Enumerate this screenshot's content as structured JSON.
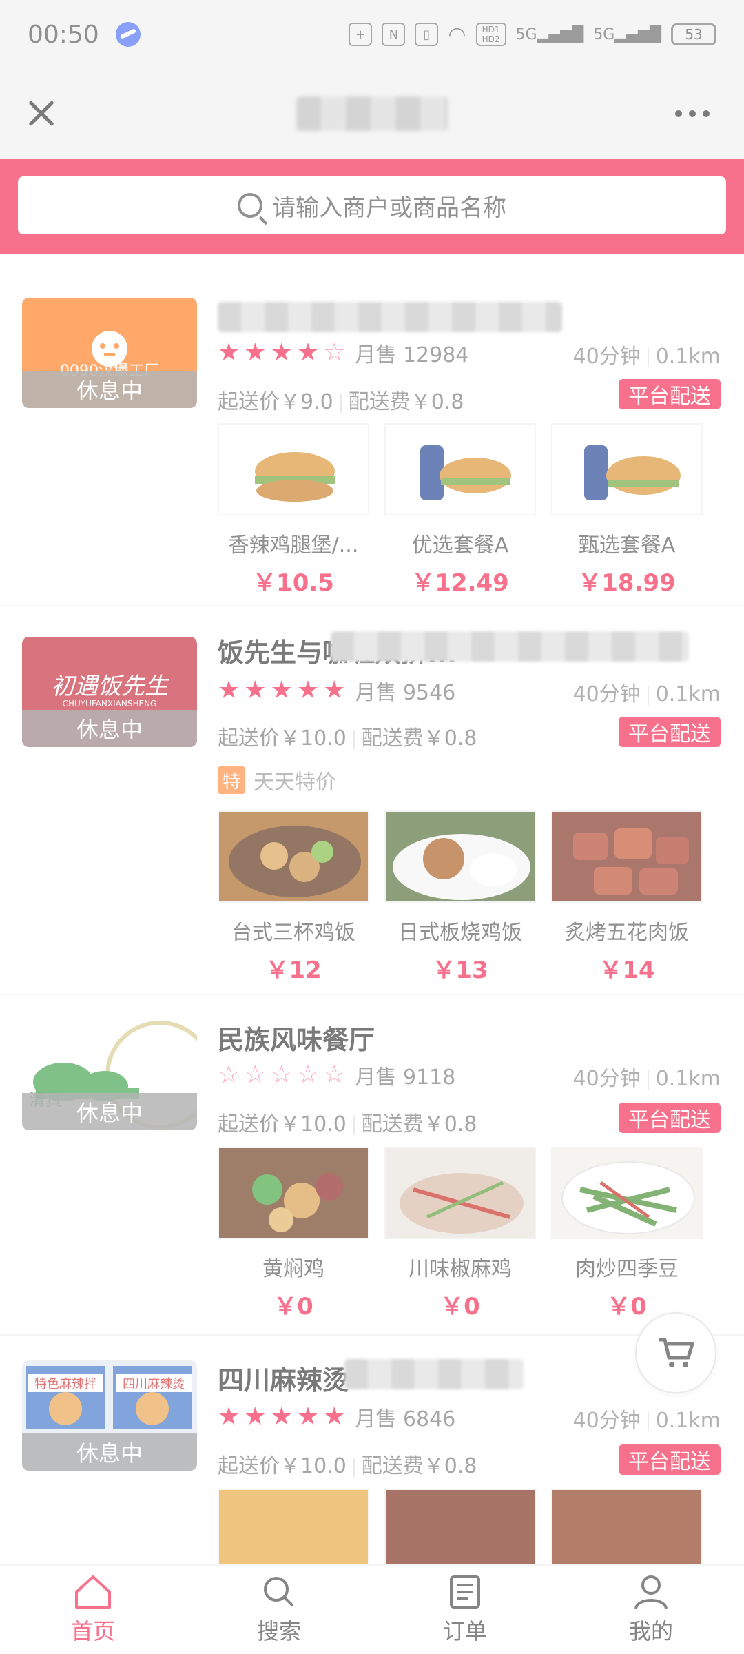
{
  "status": {
    "time": "00:50",
    "battery": "53",
    "net1": "HD1 HD2",
    "net2": "5G",
    "net3": "5G"
  },
  "search": {
    "placeholder": "请输入商户或商品名称"
  },
  "shops": [
    {
      "logo_text": "0090汉堡工厂",
      "status_badge": "休息中",
      "name": "",
      "rating": 4,
      "sales": "月售 12984",
      "time": "40分钟",
      "distance": "0.1km",
      "min_price": "起送价￥9.0",
      "delivery_fee": "配送费￥0.8",
      "delivery_badge": "平台配送",
      "products": [
        {
          "name": "香辣鸡腿堡/...",
          "price": "￥10.5"
        },
        {
          "name": "优选套餐A",
          "price": "￥12.49"
        },
        {
          "name": "甄选套餐A",
          "price": "￥18.99"
        }
      ]
    },
    {
      "logo_text": "初遇饭先生",
      "logo_sub": "CHUYUFANXIANSHENG",
      "status_badge": "休息中",
      "name": "饭先生与咖喱双拼...",
      "rating": 5,
      "sales": "月售 9546",
      "time": "40分钟",
      "distance": "0.1km",
      "min_price": "起送价￥10.0",
      "delivery_fee": "配送费￥0.8",
      "delivery_badge": "平台配送",
      "promo_tag": "特",
      "promo_text": "天天特价",
      "products": [
        {
          "name": "台式三杯鸡饭",
          "price": "￥12"
        },
        {
          "name": "日式板烧鸡饭",
          "price": "￥13"
        },
        {
          "name": "炙烤五花肉饭",
          "price": "￥14"
        }
      ]
    },
    {
      "logo_text": "清真",
      "status_badge": "休息中",
      "name": "民族风味餐厅",
      "rating": 0,
      "sales": "月售 9118",
      "time": "40分钟",
      "distance": "0.1km",
      "min_price": "起送价￥10.0",
      "delivery_fee": "配送费￥0.8",
      "delivery_badge": "平台配送",
      "products": [
        {
          "name": "黄焖鸡",
          "price": "￥0"
        },
        {
          "name": "川味椒麻鸡",
          "price": "￥0"
        },
        {
          "name": "肉炒四季豆",
          "price": "￥0"
        }
      ]
    },
    {
      "logo_text": "特色麻辣拌",
      "logo_text2": "四川麻辣烫",
      "status_badge": "休息中",
      "name": "四川麻辣烫",
      "rating": 5,
      "sales": "月售 6846",
      "time": "40分钟",
      "distance": "0.1km",
      "min_price": "起送价￥10.0",
      "delivery_fee": "配送费￥0.8",
      "delivery_badge": "平台配送"
    }
  ],
  "tabs": [
    {
      "label": "首页",
      "icon": "home-icon"
    },
    {
      "label": "搜索",
      "icon": "search-icon"
    },
    {
      "label": "订单",
      "icon": "order-icon"
    },
    {
      "label": "我的",
      "icon": "profile-icon"
    }
  ],
  "colors": {
    "accent": "#f5264f",
    "promo": "#ff8a3d"
  }
}
